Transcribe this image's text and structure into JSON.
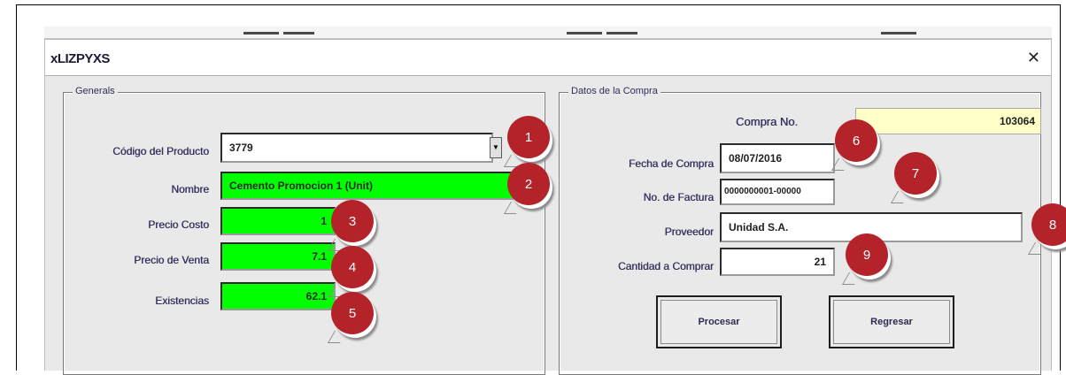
{
  "window": {
    "title": "xLIZPYXS",
    "close_symbol": "✕"
  },
  "left_group": {
    "legend": "Generals",
    "rows": [
      {
        "label": "Código del Producto",
        "value": "3779"
      },
      {
        "label": "Nombre",
        "value": "Cemento Promocion 1 (Unit)"
      },
      {
        "label": "Precio Costo",
        "value": "1"
      },
      {
        "label": "Precio de Venta",
        "value": "7.1"
      },
      {
        "label": "Existencias",
        "value": "62.1"
      }
    ]
  },
  "right_group": {
    "legend": "Datos de la Compra",
    "purchase_label": "Compra No.",
    "purchase_number": "103064",
    "rows": [
      {
        "label": "Fecha de Compra",
        "value": "08/07/2016"
      },
      {
        "label": "No. de Factura",
        "value": "0000000001-00000"
      },
      {
        "label": "Proveedor",
        "value": "Unidad S.A."
      },
      {
        "label": "Cantidad a Comprar",
        "value": "21"
      }
    ],
    "buttons": {
      "process": "Procesar",
      "cancel": "Regresar"
    }
  },
  "markers": [
    "1",
    "2",
    "3",
    "4",
    "5",
    "6",
    "7",
    "8",
    "9"
  ],
  "colors": {
    "accent_green": "#00ff00",
    "marker_red": "#b4232a",
    "highlight_yellow": "#ffffc8"
  }
}
